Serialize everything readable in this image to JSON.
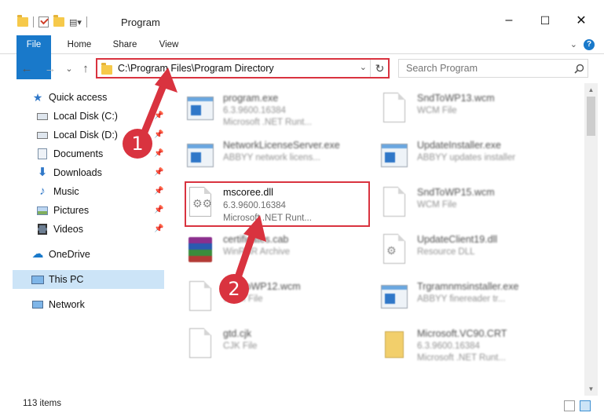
{
  "window": {
    "title": "Program",
    "controls": [
      "–",
      "☐",
      "✕"
    ]
  },
  "ribbon": {
    "tabs": [
      "File",
      "Home",
      "Share",
      "View"
    ]
  },
  "address": {
    "path": "C:\\Program Files\\Program Directory",
    "dropdown_glyph": "⌄",
    "refresh_glyph": "↻"
  },
  "search": {
    "placeholder": "Search Program"
  },
  "nav": {
    "back": "←",
    "forward": "→",
    "recent": "⌄",
    "up": "↑",
    "items": [
      {
        "label": "Quick access",
        "icon": "star-icon",
        "pinned": false
      },
      {
        "label": "Local Disk (C:)",
        "icon": "drive-icon",
        "pinned": true
      },
      {
        "label": "Local Disk (D:)",
        "icon": "drive-icon",
        "pinned": true
      },
      {
        "label": "Documents",
        "icon": "documents-icon",
        "pinned": true
      },
      {
        "label": "Downloads",
        "icon": "download-icon",
        "pinned": true
      },
      {
        "label": "Music",
        "icon": "music-icon",
        "pinned": true
      },
      {
        "label": "Pictures",
        "icon": "pictures-icon",
        "pinned": true
      },
      {
        "label": "Videos",
        "icon": "videos-icon",
        "pinned": true
      },
      {
        "label": "OneDrive",
        "icon": "cloud-icon",
        "pinned": false
      },
      {
        "label": "This PC",
        "icon": "computer-icon",
        "pinned": false,
        "selected": true
      },
      {
        "label": "Network",
        "icon": "network-icon",
        "pinned": false
      }
    ]
  },
  "files": [
    {
      "name": "program.exe",
      "line1": "6.3.9600.16384",
      "line2": "Microsoft .NET Runt...",
      "icon": "exe-icon",
      "blurred": true
    },
    {
      "name": "SndToWP13.wcm",
      "line1": "WCM File",
      "line2": "",
      "icon": "document-icon",
      "blurred": true
    },
    {
      "name": "NetworkLicenseServer.exe",
      "line1": "ABBYY network licens...",
      "line2": "",
      "icon": "exe-icon",
      "blurred": true
    },
    {
      "name": "UpdateInstaller.exe",
      "line1": "ABBYY updates installer",
      "line2": "",
      "icon": "exe-icon",
      "blurred": true
    },
    {
      "name": "mscoree.dll",
      "line1": "6.3.9600.16384",
      "line2": "Microsoft .NET Runt...",
      "icon": "dll-icon",
      "blurred": false
    },
    {
      "name": "SndToWP15.wcm",
      "line1": "WCM File",
      "line2": "",
      "icon": "document-icon",
      "blurred": true
    },
    {
      "name": "certificates.cab",
      "line1": "WinRAR Archive",
      "line2": "",
      "icon": "archive-icon",
      "blurred": true
    },
    {
      "name": "UpdateClient19.dll",
      "line1": "Resource DLL",
      "line2": "",
      "icon": "dll-icon",
      "blurred": true
    },
    {
      "name": "SndToWP12.wcm",
      "line1": "WCM File",
      "line2": "",
      "icon": "document-icon",
      "blurred": true
    },
    {
      "name": "Trgramnmsinstaller.exe",
      "line1": "ABBYY finereader tr...",
      "line2": "",
      "icon": "exe-icon",
      "blurred": true
    },
    {
      "name": "gtd.cjk",
      "line1": "CJK File",
      "line2": "",
      "icon": "document-icon",
      "blurred": true
    },
    {
      "name": "Microsoft.VC90.CRT",
      "line1": "6.3.9600.16384",
      "line2": "Microsoft .NET Runt...",
      "icon": "manifest-icon",
      "blurred": true
    }
  ],
  "status": {
    "item_count": "113 items"
  },
  "annotations": {
    "step1": "1",
    "step2": "2",
    "color": "#d9333f"
  }
}
